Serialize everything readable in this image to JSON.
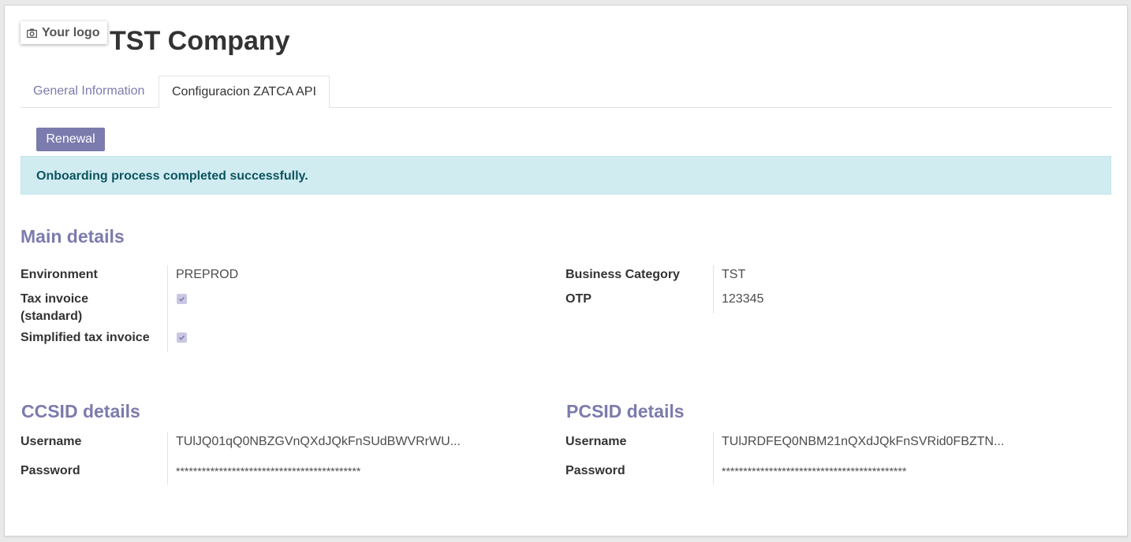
{
  "header": {
    "logo_text": "Your logo",
    "company_name": "TST Company"
  },
  "tabs": [
    {
      "label": "General Information",
      "active": false
    },
    {
      "label": "Configuracion ZATCA API",
      "active": true
    }
  ],
  "actions": {
    "renewal_label": "Renewal"
  },
  "alert": {
    "message": "Onboarding process completed successfully."
  },
  "main_details": {
    "title": "Main details",
    "environment_label": "Environment",
    "environment_value": "PREPROD",
    "tax_invoice_label_line1": "Tax invoice",
    "tax_invoice_label_line2": "(standard)",
    "tax_invoice_checked": true,
    "simplified_label": "Simplified tax invoice",
    "simplified_checked": true,
    "business_category_label": "Business Category",
    "business_category_value": "TST",
    "otp_label": "OTP",
    "otp_value": "123345"
  },
  "ccsid": {
    "title": "CCSID details",
    "username_label": "Username",
    "username_value": "TUlJQ01qQ0NBZGVnQXdJQkFnSUdBWVRrWU...",
    "password_label": "Password",
    "password_value": "*******************************************"
  },
  "pcsid": {
    "title": "PCSID details",
    "username_label": "Username",
    "username_value": "TUlJRDFEQ0NBM21nQXdJQkFnSVRid0FBZTN...",
    "password_label": "Password",
    "password_value": "*******************************************"
  },
  "colors": {
    "accent": "#7c7bad",
    "alert_bg": "#d1ecf1",
    "alert_text": "#0c5460"
  }
}
